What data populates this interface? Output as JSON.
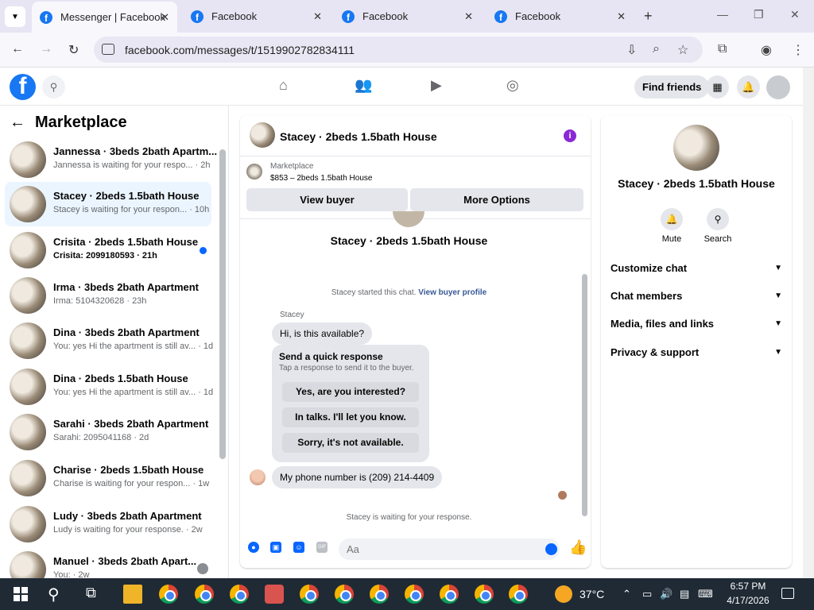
{
  "browser": {
    "tabs": [
      {
        "title": "Messenger | Facebook",
        "active": true
      },
      {
        "title": "Facebook",
        "active": false
      },
      {
        "title": "Facebook",
        "active": false
      },
      {
        "title": "Facebook",
        "active": false
      }
    ],
    "url": "facebook.com/messages/t/1519902782834111"
  },
  "header": {
    "find_friends": "Find friends"
  },
  "left_panel": {
    "title": "Marketplace",
    "conversations": [
      {
        "name": "Jannessa · 3beds 2bath Apartm...",
        "preview": "Jannessa is waiting for your respo... · 2h",
        "selected": false,
        "unread": false
      },
      {
        "name": "Stacey · 2beds 1.5bath House",
        "preview": "Stacey is waiting for your respon... · 10h",
        "selected": true,
        "unread": false
      },
      {
        "name": "Crisita · 2beds 1.5bath House",
        "preview": "Crisita: 2099180593 · 21h",
        "selected": false,
        "unread": true
      },
      {
        "name": "Irma · 3beds 2bath Apartment",
        "preview": "Irma: 5104320628 · 23h",
        "selected": false,
        "unread": false
      },
      {
        "name": "Dina · 3beds 2bath Apartment",
        "preview": "You: yes Hi the apartment is still av... · 1d",
        "selected": false,
        "unread": false
      },
      {
        "name": "Dina · 2beds 1.5bath House",
        "preview": "You: yes Hi the apartment is still av... · 1d",
        "selected": false,
        "unread": false
      },
      {
        "name": "Sarahi · 3beds 2bath Apartment",
        "preview": "Sarahi: 2095041168 · 2d",
        "selected": false,
        "unread": false
      },
      {
        "name": "Charise · 2beds 1.5bath House",
        "preview": "Charise is waiting for your respon... · 1w",
        "selected": false,
        "unread": false
      },
      {
        "name": "Ludy · 3beds 2bath Apartment",
        "preview": "Ludy is waiting for your response. · 2w",
        "selected": false,
        "unread": false
      },
      {
        "name": "Manuel · 3beds 2bath Apart...",
        "preview": "You: · 2w",
        "selected": false,
        "unread": false
      }
    ]
  },
  "chat": {
    "title": "Stacey · 2beds 1.5bath House",
    "marketplace_label": "Marketplace",
    "listing": "$853 – 2beds 1.5bath House",
    "view_buyer": "View buyer",
    "more_options": "More Options",
    "chat_name": "Stacey · 2beds 1.5bath House",
    "started_text": "Stacey started this chat.",
    "view_buyer_profile": "View buyer profile",
    "sender": "Stacey",
    "message1": "Hi, is this available?",
    "quick_title": "Send a quick response",
    "quick_sub": "Tap a response to send it to the buyer.",
    "quick_responses": [
      "Yes, are you interested?",
      "In talks. I'll let you know.",
      "Sorry, it's not available."
    ],
    "message2": "My phone number is (209) 214-4409",
    "waiting": "Stacey is waiting for your response.",
    "composer_placeholder": "Aa"
  },
  "right_panel": {
    "name": "Stacey · 2beds 1.5bath House",
    "mute": "Mute",
    "search": "Search",
    "items": [
      "Customize chat",
      "Chat members",
      "Media, files and links",
      "Privacy & support"
    ]
  },
  "taskbar": {
    "temperature": "37°C",
    "time": "6:57 PM",
    "date": "4/17/2026"
  },
  "colors": {
    "facebook_blue": "#1877f2",
    "messenger_blue": "#0866ff",
    "selected_bg": "#ebf5ff",
    "info_purple": "#8b28d6"
  }
}
